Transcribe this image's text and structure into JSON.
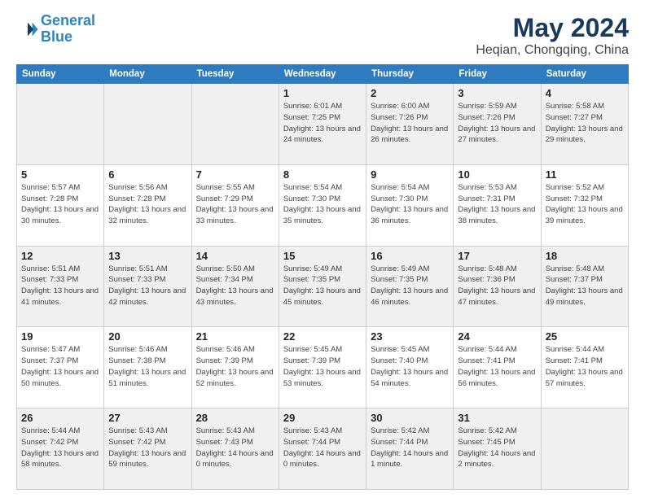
{
  "header": {
    "logo_line1": "General",
    "logo_line2": "Blue",
    "title": "May 2024",
    "subtitle": "Heqian, Chongqing, China"
  },
  "weekdays": [
    "Sunday",
    "Monday",
    "Tuesday",
    "Wednesday",
    "Thursday",
    "Friday",
    "Saturday"
  ],
  "weeks": [
    [
      {
        "day": "",
        "info": ""
      },
      {
        "day": "",
        "info": ""
      },
      {
        "day": "",
        "info": ""
      },
      {
        "day": "1",
        "info": "Sunrise: 6:01 AM\nSunset: 7:25 PM\nDaylight: 13 hours and 24 minutes."
      },
      {
        "day": "2",
        "info": "Sunrise: 6:00 AM\nSunset: 7:26 PM\nDaylight: 13 hours and 26 minutes."
      },
      {
        "day": "3",
        "info": "Sunrise: 5:59 AM\nSunset: 7:26 PM\nDaylight: 13 hours and 27 minutes."
      },
      {
        "day": "4",
        "info": "Sunrise: 5:58 AM\nSunset: 7:27 PM\nDaylight: 13 hours and 29 minutes."
      }
    ],
    [
      {
        "day": "5",
        "info": "Sunrise: 5:57 AM\nSunset: 7:28 PM\nDaylight: 13 hours and 30 minutes."
      },
      {
        "day": "6",
        "info": "Sunrise: 5:56 AM\nSunset: 7:28 PM\nDaylight: 13 hours and 32 minutes."
      },
      {
        "day": "7",
        "info": "Sunrise: 5:55 AM\nSunset: 7:29 PM\nDaylight: 13 hours and 33 minutes."
      },
      {
        "day": "8",
        "info": "Sunrise: 5:54 AM\nSunset: 7:30 PM\nDaylight: 13 hours and 35 minutes."
      },
      {
        "day": "9",
        "info": "Sunrise: 5:54 AM\nSunset: 7:30 PM\nDaylight: 13 hours and 36 minutes."
      },
      {
        "day": "10",
        "info": "Sunrise: 5:53 AM\nSunset: 7:31 PM\nDaylight: 13 hours and 38 minutes."
      },
      {
        "day": "11",
        "info": "Sunrise: 5:52 AM\nSunset: 7:32 PM\nDaylight: 13 hours and 39 minutes."
      }
    ],
    [
      {
        "day": "12",
        "info": "Sunrise: 5:51 AM\nSunset: 7:33 PM\nDaylight: 13 hours and 41 minutes."
      },
      {
        "day": "13",
        "info": "Sunrise: 5:51 AM\nSunset: 7:33 PM\nDaylight: 13 hours and 42 minutes."
      },
      {
        "day": "14",
        "info": "Sunrise: 5:50 AM\nSunset: 7:34 PM\nDaylight: 13 hours and 43 minutes."
      },
      {
        "day": "15",
        "info": "Sunrise: 5:49 AM\nSunset: 7:35 PM\nDaylight: 13 hours and 45 minutes."
      },
      {
        "day": "16",
        "info": "Sunrise: 5:49 AM\nSunset: 7:35 PM\nDaylight: 13 hours and 46 minutes."
      },
      {
        "day": "17",
        "info": "Sunrise: 5:48 AM\nSunset: 7:36 PM\nDaylight: 13 hours and 47 minutes."
      },
      {
        "day": "18",
        "info": "Sunrise: 5:48 AM\nSunset: 7:37 PM\nDaylight: 13 hours and 49 minutes."
      }
    ],
    [
      {
        "day": "19",
        "info": "Sunrise: 5:47 AM\nSunset: 7:37 PM\nDaylight: 13 hours and 50 minutes."
      },
      {
        "day": "20",
        "info": "Sunrise: 5:46 AM\nSunset: 7:38 PM\nDaylight: 13 hours and 51 minutes."
      },
      {
        "day": "21",
        "info": "Sunrise: 5:46 AM\nSunset: 7:39 PM\nDaylight: 13 hours and 52 minutes."
      },
      {
        "day": "22",
        "info": "Sunrise: 5:45 AM\nSunset: 7:39 PM\nDaylight: 13 hours and 53 minutes."
      },
      {
        "day": "23",
        "info": "Sunrise: 5:45 AM\nSunset: 7:40 PM\nDaylight: 13 hours and 54 minutes."
      },
      {
        "day": "24",
        "info": "Sunrise: 5:44 AM\nSunset: 7:41 PM\nDaylight: 13 hours and 56 minutes."
      },
      {
        "day": "25",
        "info": "Sunrise: 5:44 AM\nSunset: 7:41 PM\nDaylight: 13 hours and 57 minutes."
      }
    ],
    [
      {
        "day": "26",
        "info": "Sunrise: 5:44 AM\nSunset: 7:42 PM\nDaylight: 13 hours and 58 minutes."
      },
      {
        "day": "27",
        "info": "Sunrise: 5:43 AM\nSunset: 7:42 PM\nDaylight: 13 hours and 59 minutes."
      },
      {
        "day": "28",
        "info": "Sunrise: 5:43 AM\nSunset: 7:43 PM\nDaylight: 14 hours and 0 minutes."
      },
      {
        "day": "29",
        "info": "Sunrise: 5:43 AM\nSunset: 7:44 PM\nDaylight: 14 hours and 0 minutes."
      },
      {
        "day": "30",
        "info": "Sunrise: 5:42 AM\nSunset: 7:44 PM\nDaylight: 14 hours and 1 minute."
      },
      {
        "day": "31",
        "info": "Sunrise: 5:42 AM\nSunset: 7:45 PM\nDaylight: 14 hours and 2 minutes."
      },
      {
        "day": "",
        "info": ""
      }
    ]
  ]
}
